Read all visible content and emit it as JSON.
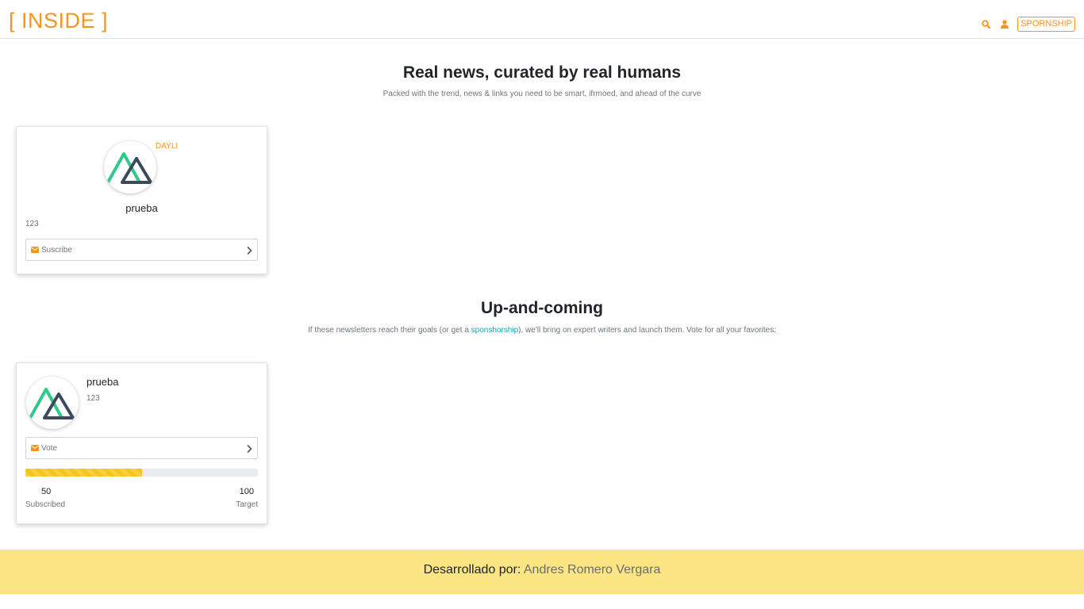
{
  "header": {
    "brand": "[ INSIDE ]",
    "sponsorship_label": "SPORNSHIP",
    "icons": [
      "search-icon",
      "user-icon"
    ]
  },
  "hero": {
    "title": "Real news, curated by real humans",
    "subtitle": "Packed with the trend, news & links you need to be smart, ifrmoed, and ahead of the curve"
  },
  "featured": {
    "card": {
      "badge": "DAYLI",
      "name": "prueba",
      "count": "123",
      "button_label": "Suscribe"
    }
  },
  "upcoming": {
    "title": "Up-and-coming",
    "subtitle_before": "If these newsletters reach their goals (or get a ",
    "subtitle_link": "sponshorship",
    "subtitle_after": "), we'll bring on expert writers and launch them. Vote for all your favorites:",
    "card": {
      "name": "prueba",
      "count": "123",
      "button_label": "Vote",
      "progress_fraction": 0.5,
      "subscribed_value": "50",
      "subscribed_label": "Subscribed",
      "target_value": "100",
      "target_label": "Target"
    }
  },
  "footer": {
    "prefix": "Desarrollado por: ",
    "author": "Andres Romero Vergara"
  },
  "colors": {
    "brand_orange": "#f7941d",
    "footer_yellow": "#fbe683",
    "progress_yellow": "#f5c518",
    "link_teal": "#17a2b8"
  }
}
